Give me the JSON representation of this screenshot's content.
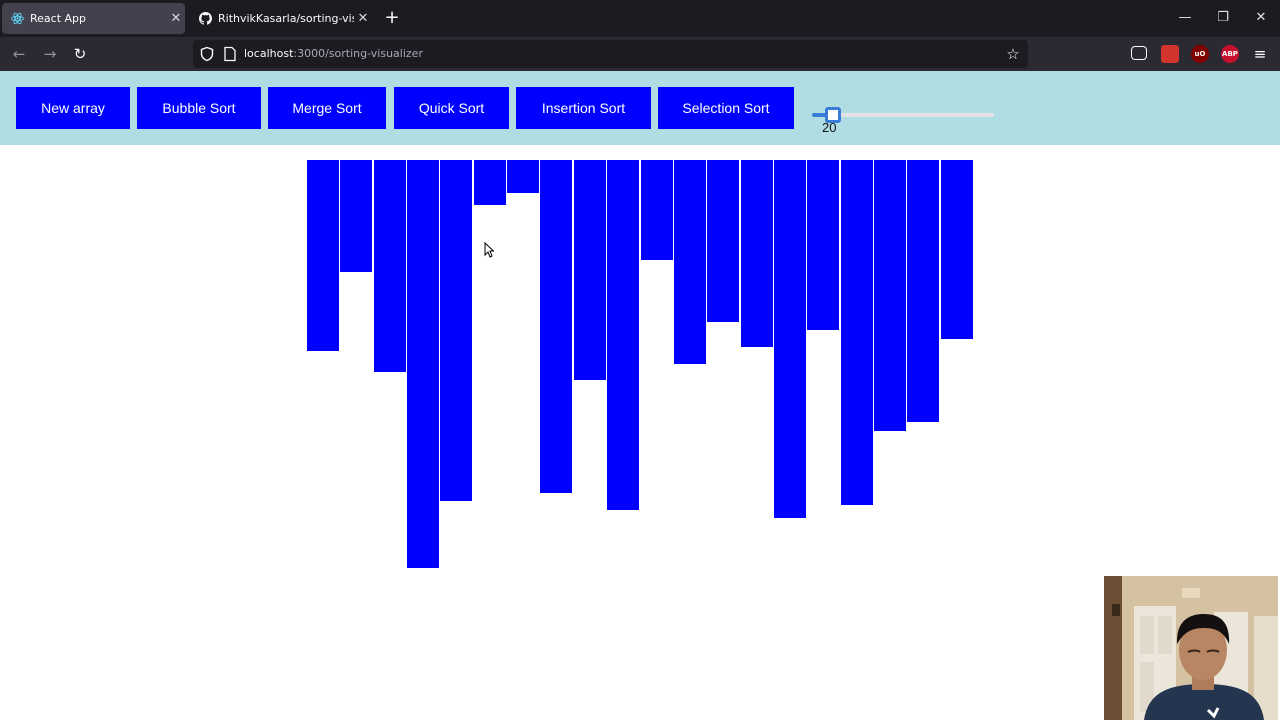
{
  "browser": {
    "tabs": [
      {
        "title": "React App",
        "active": true,
        "icon": "react-icon"
      },
      {
        "title": "RithvikKasarla/sorting-visualizer",
        "active": false,
        "icon": "github-icon"
      }
    ],
    "url_host": "localhost",
    "url_rest": ":3000/sorting-visualizer",
    "extensions": [
      {
        "name": "pocket-icon",
        "label": ""
      },
      {
        "name": "extension-red-icon",
        "label": ""
      },
      {
        "name": "ublock-icon",
        "label": "uO"
      },
      {
        "name": "adblock-plus-icon",
        "label": "ABP"
      }
    ]
  },
  "toolbar": {
    "buttons": [
      {
        "label": "New array"
      },
      {
        "label": "Bubble Sort"
      },
      {
        "label": "Merge Sort"
      },
      {
        "label": "Quick Sort"
      },
      {
        "label": "Insertion Sort"
      },
      {
        "label": "Selection Sort"
      }
    ],
    "button_color": "#0000ff",
    "background_color": "#b0dde4",
    "slider": {
      "value": "20",
      "fraction": 0.08
    }
  },
  "array": {
    "values": [
      191,
      112,
      212,
      408,
      341,
      45,
      33,
      333,
      220,
      350,
      100,
      204,
      162,
      187,
      358,
      170,
      345,
      271,
      262,
      179
    ],
    "bar_color": "#0000ff"
  }
}
